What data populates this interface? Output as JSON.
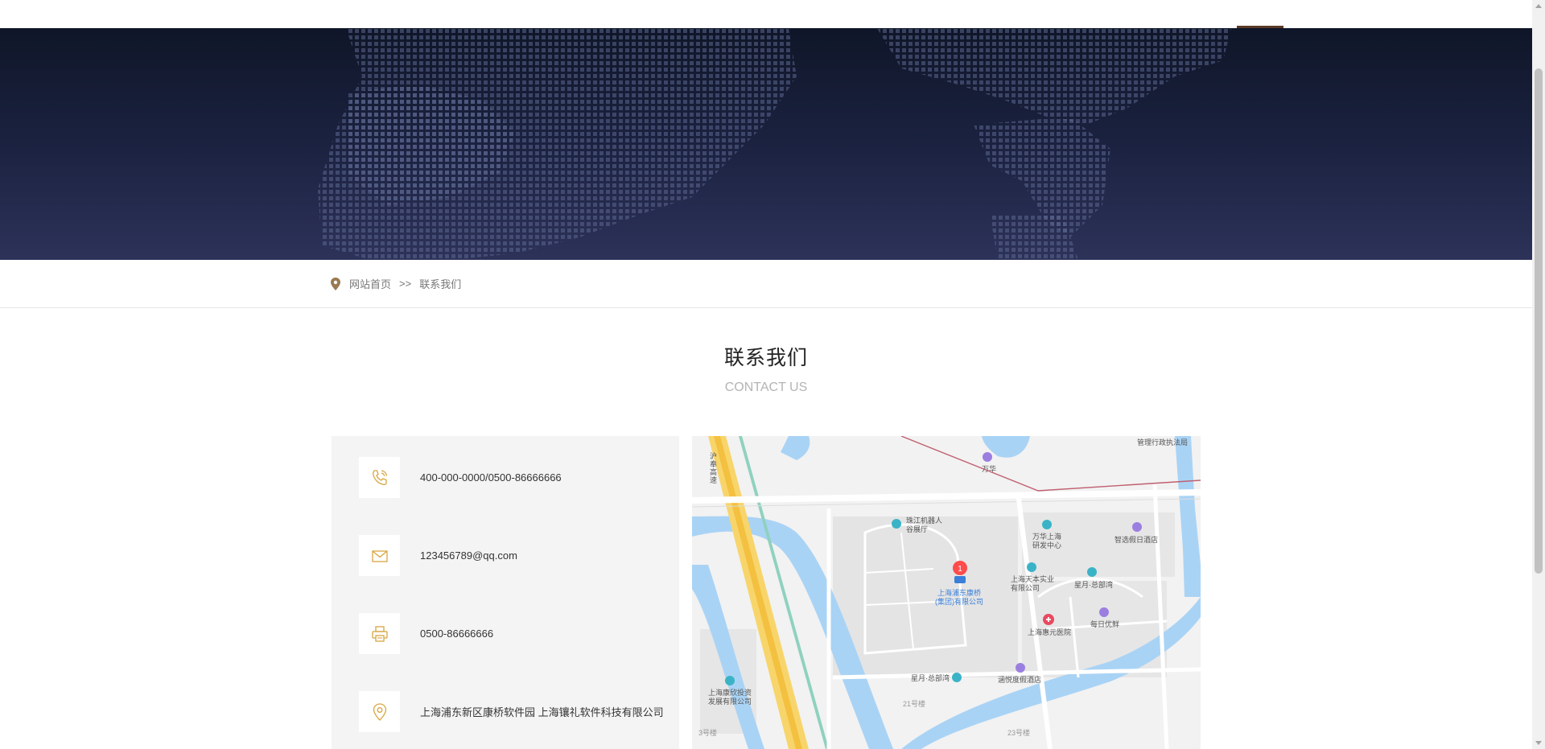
{
  "breadcrumb": {
    "home": "网站首页",
    "separator": ">>",
    "current": "联系我们"
  },
  "section": {
    "title": "联系我们",
    "subtitle": "CONTACT US"
  },
  "contact": {
    "phone": "400-000-0000/0500-86666666",
    "email": "123456789@qq.com",
    "fax": "0500-86666666",
    "address": "上海浦东新区康桥软件园 上海镶礼软件科技有限公司"
  },
  "map": {
    "marker_count": "1",
    "labels": {
      "road_hu": "沪\n奉\n高\n速",
      "wanhua": "万华",
      "guanli": "管理行政执法局",
      "zhujiang": "珠江机器人\n谷展厅",
      "wanhua_center": "万华上海\n研发中心",
      "zhixuan": "智选假日酒店",
      "target": "上海浦东康桥\n(集团)有限公司",
      "tianben": "上海天本实业\n有限公司",
      "xingyue": "星月·总部湾",
      "huiyuan": "上海惠元医院",
      "meiri": "每日优鲜",
      "xingyue2": "星月·总部湾",
      "hanyue": "涵悦度假酒店",
      "kangxin": "上海康欣投资\n发展有限公司",
      "no21": "21号楼",
      "no23": "23号楼",
      "no3": "3号楼"
    }
  },
  "colors": {
    "accent_gold": "#d8a640",
    "banner_top": "#0f1628",
    "banner_bottom": "#2d3259",
    "breadcrumb_icon": "#9a7a52"
  },
  "icons": {
    "phone": "phone-icon",
    "email": "envelope-icon",
    "fax": "printer-icon",
    "address": "location-pin-icon"
  }
}
